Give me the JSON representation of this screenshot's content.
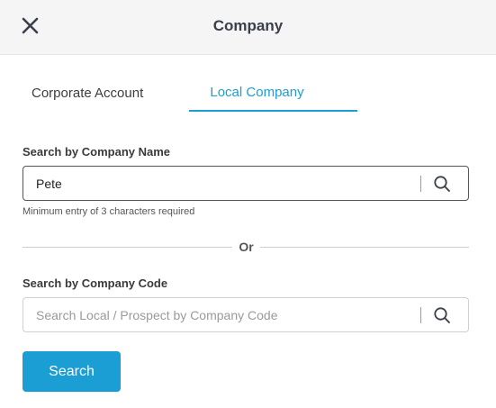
{
  "header": {
    "title": "Company",
    "close_icon": "close-icon"
  },
  "tabs": [
    {
      "label": "Corporate Account",
      "active": false
    },
    {
      "label": "Local Company",
      "active": true
    }
  ],
  "accent_color": "#1a9ed4",
  "search_by_name": {
    "label": "Search by Company Name",
    "value": "Pete",
    "placeholder": "",
    "hint": "Minimum entry of 3 characters required"
  },
  "or_separator": "Or",
  "search_by_code": {
    "label": "Search by Company Code",
    "value": "",
    "placeholder": "Search Local / Prospect by Company Code"
  },
  "search_button_label": "Search"
}
